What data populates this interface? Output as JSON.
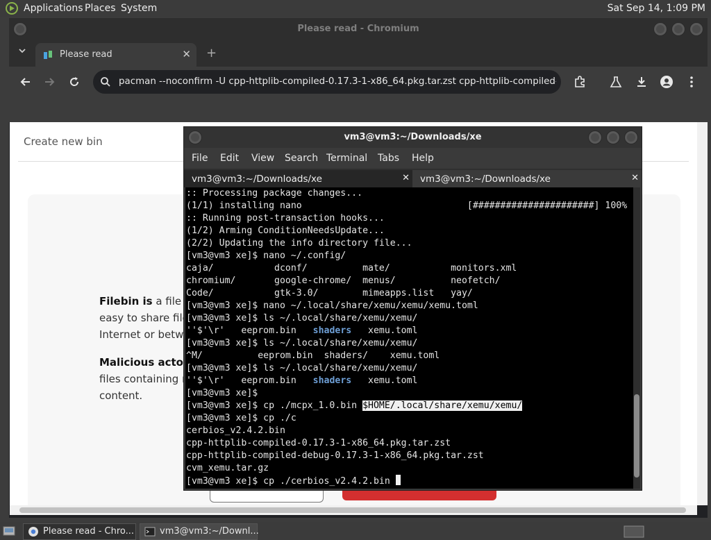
{
  "top_panel": {
    "menus": [
      "Applications",
      "Places",
      "System"
    ],
    "clock": "Sat Sep 14,  1:09 PM"
  },
  "chromium": {
    "window_title": "Please read - Chromium",
    "tab_title": "Please read",
    "address": "pacman --noconfirm -U cpp-httplib-compiled-0.17.3-1-x86_64.pkg.tar.zst cpp-httplib-compiled-...",
    "page": {
      "create_bin": "Create new bin",
      "para1": [
        "Filebin is",
        " a file sh",
        "easy to share files",
        "Internet or betwe"
      ],
      "para2": [
        "Malicious actors",
        "files containing m",
        "content."
      ]
    }
  },
  "terminal": {
    "title": "vm3@vm3:~/Downloads/xe",
    "menus": [
      "File",
      "Edit",
      "View",
      "Search",
      "Terminal",
      "Tabs",
      "Help"
    ],
    "tabs": [
      "vm3@vm3:~/Downloads/xe",
      "vm3@vm3:~/Downloads/xe"
    ],
    "lines": [
      ":: Processing package changes...",
      "(1/1) installing nano                              [######################] 100%",
      ":: Running post-transaction hooks...",
      "(1/2) Arming ConditionNeedsUpdate...",
      "(2/2) Updating the info directory file...",
      "[vm3@vm3 xe]$ nano ~/.config/",
      "caja/           dconf/          mate/           monitors.xml",
      "chromium/       google-chrome/  menus/          neofetch/",
      "Code/           gtk-3.0/        mimeapps.list   yay/",
      "[vm3@vm3 xe]$ nano ~/.local/share/xemu/xemu/xemu.toml",
      "[vm3@vm3 xe]$ ls ~/.local/share/xemu/xemu/",
      "''$'\\r'   eeprom.bin   |shaders|   xemu.toml",
      "[vm3@vm3 xe]$ ls ~/.local/share/xemu/xemu/",
      "^M/          eeprom.bin  shaders/    xemu.toml",
      "[vm3@vm3 xe]$ ls ~/.local/share/xemu/xemu/",
      "''$'\\r'   eeprom.bin   |shaders|   xemu.toml",
      "[vm3@vm3 xe]$",
      "[vm3@vm3 xe]$ cp ./mcpx_1.0.bin ",
      "[vm3@vm3 xe]$ cp ./c",
      "cerbios_v2.4.2.bin",
      "cpp-httplib-compiled-0.17.3-1-x86_64.pkg.tar.zst",
      "cpp-httplib-compiled-debug-0.17.3-1-x86_64.pkg.tar.zst",
      "cvm_xemu.tar.gz",
      "[vm3@vm3 xe]$ cp ./cerbios_v2.4.2.bin "
    ],
    "ls_prefix": "''$'\\r'   eeprom.bin   ",
    "ls_dir": "shaders",
    "ls_suffix": "   xemu.toml",
    "selected_text": "$HOME/.local/share/xemu/xemu/"
  },
  "taskbar": {
    "items": [
      "Please read - Chro...",
      "vm3@vm3:~/Downl..."
    ]
  },
  "colors": {
    "panel": "#3b3b3b",
    "chrome_frame": "#3c3c3c",
    "terminal_bg": "#000000",
    "terminal_dir": "#6e9fd6",
    "accent_red": "#d32f2f"
  }
}
